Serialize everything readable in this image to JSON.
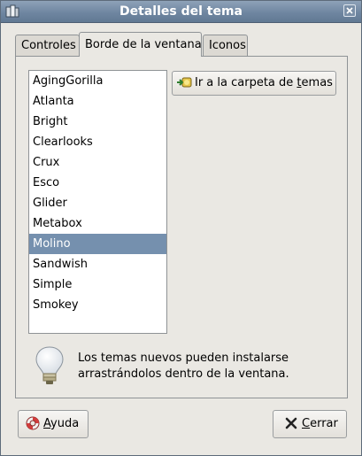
{
  "window": {
    "title": "Detalles del tema"
  },
  "tabs": [
    {
      "label": "Controles"
    },
    {
      "label": "Borde de la ventana"
    },
    {
      "label": "Iconos"
    }
  ],
  "themes": {
    "items": [
      "AgingGorilla",
      "Atlanta",
      "Bright",
      "Clearlooks",
      "Crux",
      "Esco",
      "Glider",
      "Metabox",
      "Molino",
      "Sandwish",
      "Simple",
      "Smokey"
    ],
    "selected": "Molino"
  },
  "folder_button": {
    "label_pre": "Ir a la carpeta de ",
    "label_mnemonic": "t",
    "label_post": "emas"
  },
  "hint": {
    "text": "Los temas nuevos pueden instalarse arrastrándolos dentro de la ventana."
  },
  "buttons": {
    "help": {
      "mnemonic": "A",
      "rest": "yuda"
    },
    "close": {
      "mnemonic": "C",
      "rest": "errar"
    }
  },
  "colors": {
    "titlebar": "#6f86a1",
    "selection": "#7590ae",
    "window_bg": "#eae8e3"
  }
}
